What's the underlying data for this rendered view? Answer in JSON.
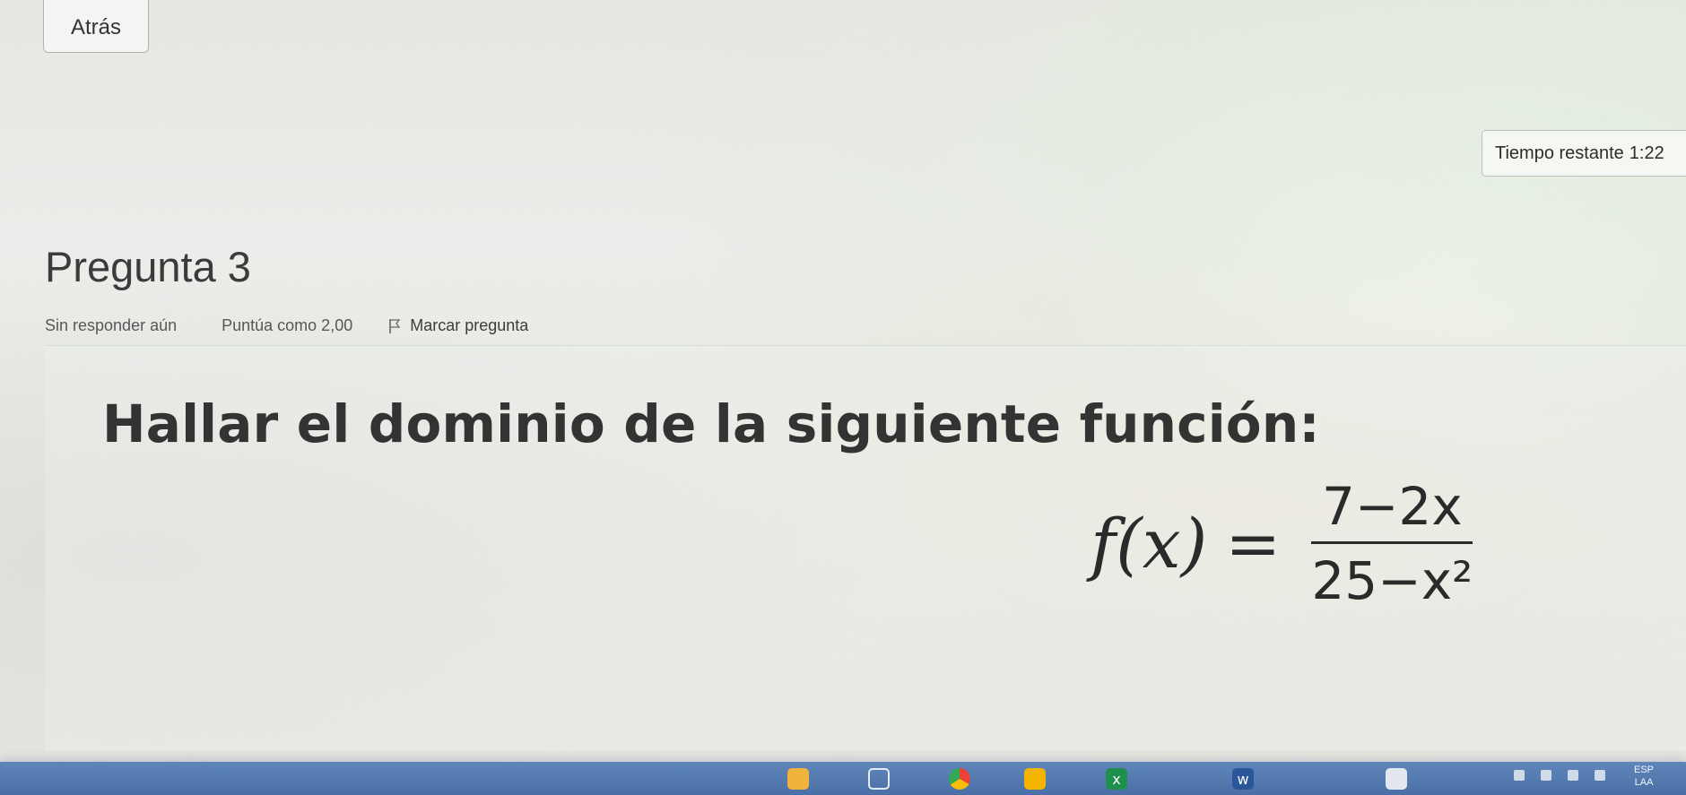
{
  "navigation": {
    "back_label": "Atrás"
  },
  "timer": {
    "label": "Tiempo restante",
    "value": "1:22"
  },
  "question": {
    "title": "Pregunta 3",
    "status": "Sin responder aún",
    "score": "Puntúa como 2,00",
    "flag_label": "Marcar pregunta",
    "prompt": "Hallar el dominio de la siguiente función:",
    "formula": {
      "lhs": "f(x)",
      "equals": "=",
      "numerator": "7−2x",
      "denominator": "25−x²"
    }
  },
  "taskbar": {
    "language_primary": "ESP",
    "language_secondary": "LAA",
    "icons": [
      {
        "name": "explorer-icon",
        "color": "#f0b33b"
      },
      {
        "name": "start-icon",
        "color": "#ffffff"
      },
      {
        "name": "chrome-icon",
        "color": "#34a853"
      },
      {
        "name": "store-icon",
        "color": "#f5b400"
      },
      {
        "name": "excel-icon",
        "color": "#1f8f4d"
      },
      {
        "name": "word-icon",
        "color": "#2b579a"
      },
      {
        "name": "chat-icon",
        "color": "#e3e7f0"
      }
    ]
  }
}
